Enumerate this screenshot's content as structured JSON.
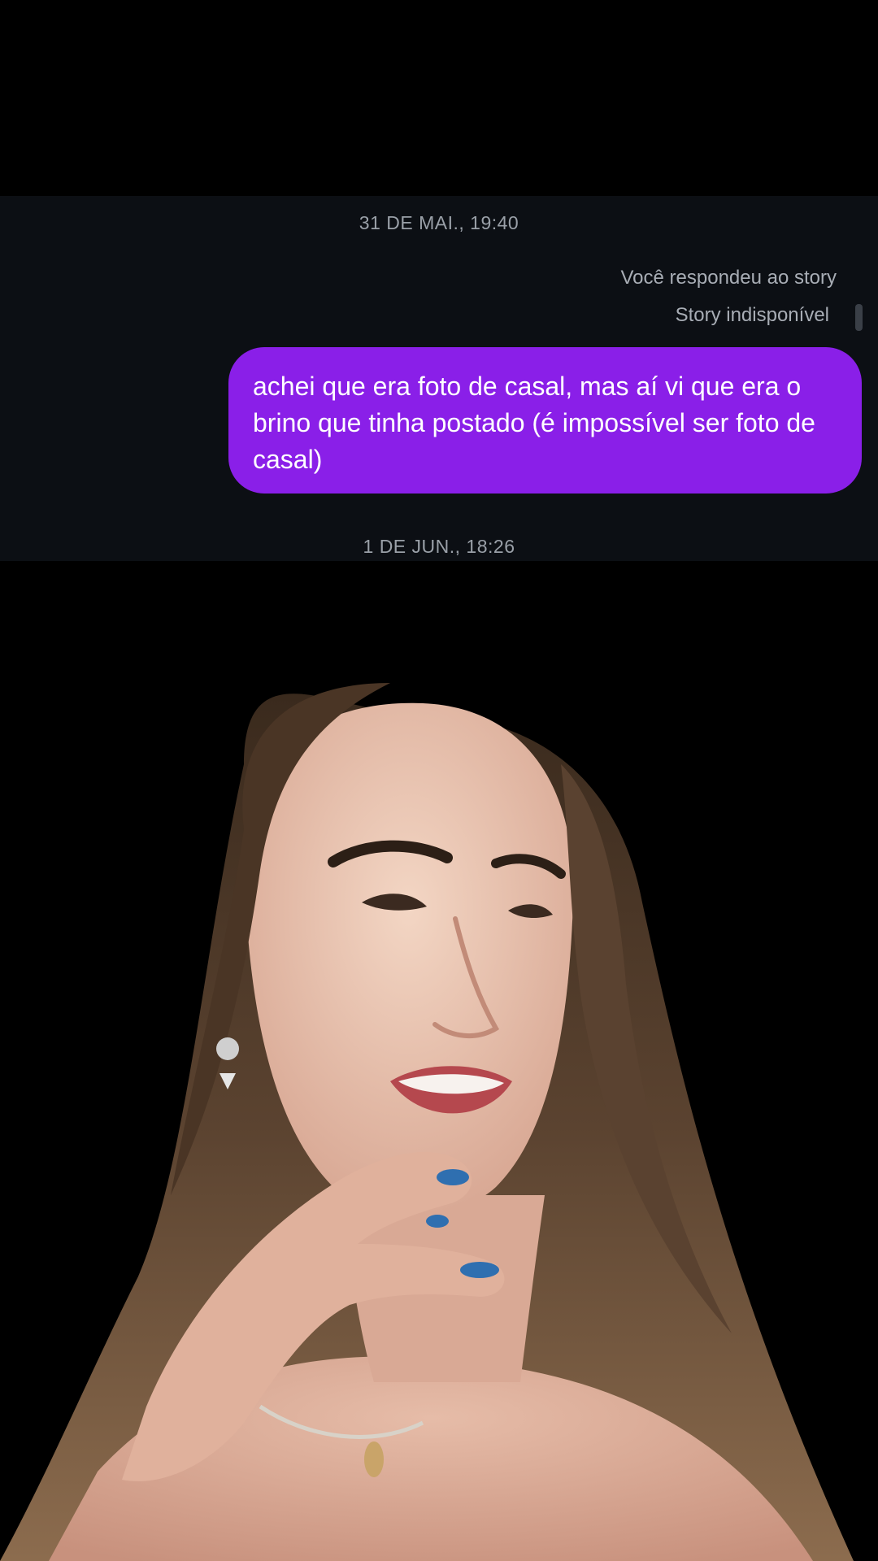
{
  "chat": {
    "timestamp_top": "31 DE MAI., 19:40",
    "reply_context": "Você respondeu ao story",
    "story_status": "Story indisponível",
    "message": "achei que era foto de casal, mas aí vi que era o brino que tinha postado (é impossível ser foto de casal)",
    "timestamp_bottom": "1 DE JUN., 18:26"
  },
  "colors": {
    "bubble": "#8a1fe8",
    "chat_background": "#0c0f14",
    "page_background": "#000000",
    "timestamp_text": "#9aa0a8"
  },
  "photo": {
    "icon": "person-photo-icon"
  }
}
